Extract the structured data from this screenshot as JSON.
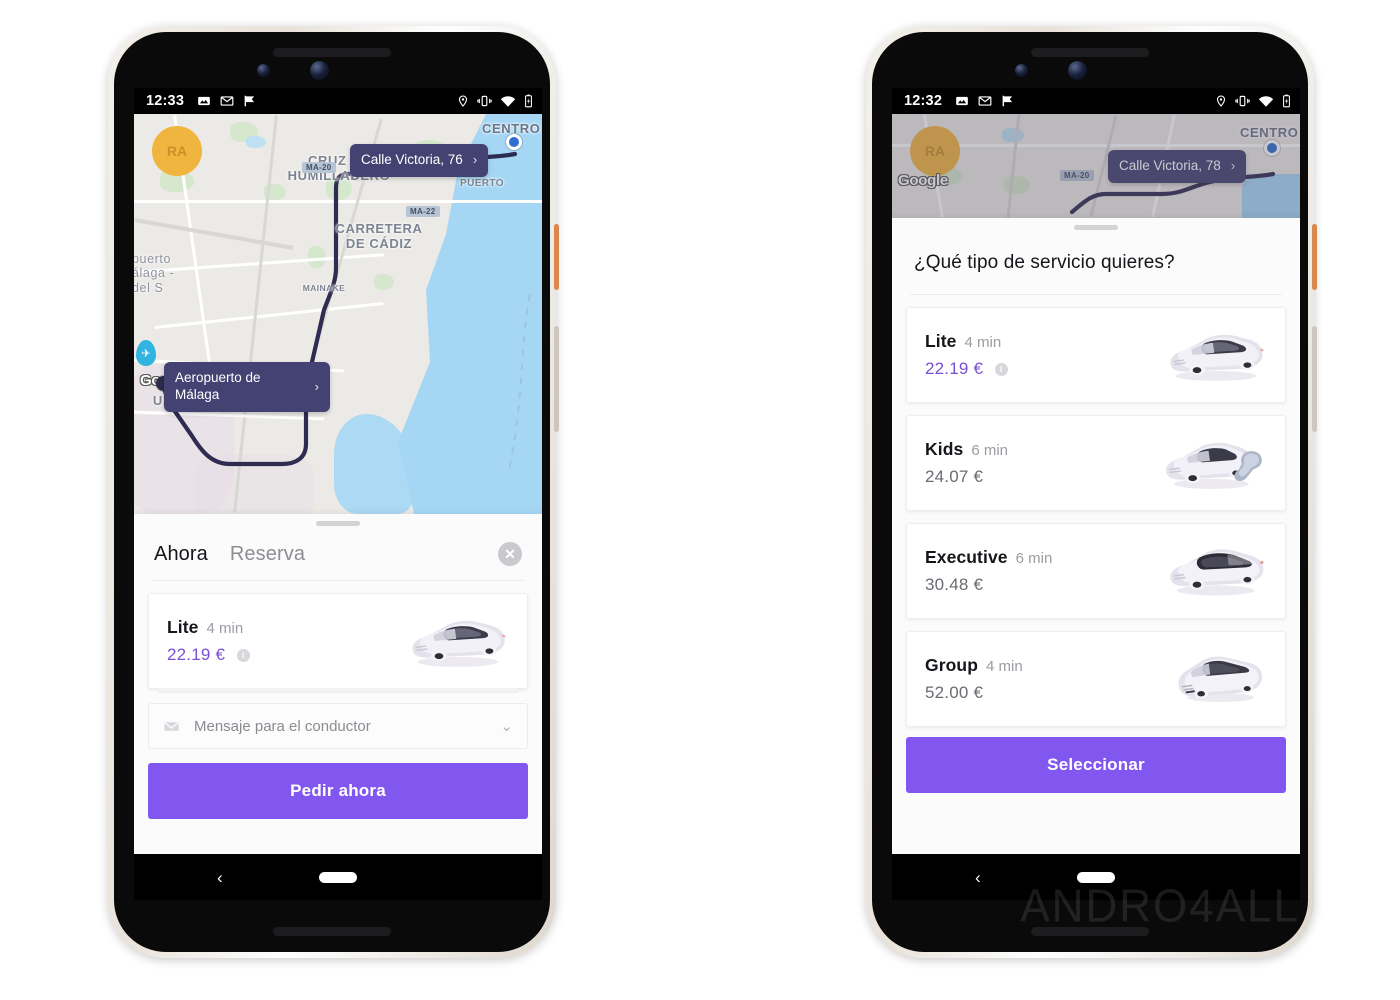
{
  "app": {
    "accent_purple": "#8257f0",
    "price_accent": "#7b4fd4",
    "callout_bg": "#434272"
  },
  "left_phone": {
    "status_bar": {
      "time": "12:33",
      "left_icons": [
        "image-icon",
        "gmail-icon",
        "flag-icon"
      ],
      "right_icons": [
        "location-icon",
        "vibrate-icon",
        "wifi-icon",
        "battery-icon"
      ]
    },
    "map": {
      "user_badge": "RA",
      "attribution": "Google",
      "labels": [
        "CENTRO",
        "CRUZ DE\nHUMILLADERO",
        "PUERTO",
        "CARRETERA\nDE CÁDIZ",
        "MAINAKE",
        "URRIANA"
      ],
      "label_centro": "CENTRO",
      "label_cruz": "CRUZ DE\nHUMILLADERO",
      "label_puerto": "PUERTO",
      "label_carretera": "CARRETERA\nDE CÁDIZ",
      "label_mainake": "MAINAKE",
      "label_urriana": "URRIANA",
      "label_aeropuerto_faint": "puerto\nálaga -\ndel S",
      "highway_1": "MA-20",
      "highway_2": "MA-22",
      "destination_callout": "Calle Victoria, 76",
      "origin_callout": "Aeropuerto de Málaga",
      "chevron": "›"
    },
    "sheet": {
      "tab_now": "Ahora",
      "tab_booking": "Reserva",
      "close_label": "✕",
      "service": {
        "name": "Lite",
        "eta": "4 min",
        "price": "22.19 €",
        "info_badge": "i"
      },
      "message_placeholder": "Mensaje para el conductor",
      "cta_label": "Pedir ahora"
    },
    "navbar": {
      "back": "‹"
    }
  },
  "right_phone": {
    "status_bar": {
      "time": "12:32",
      "left_icons": [
        "image-icon",
        "gmail-icon",
        "flag-icon"
      ],
      "right_icons": [
        "location-icon",
        "vibrate-icon",
        "wifi-icon",
        "battery-icon"
      ]
    },
    "map": {
      "user_badge": "RA",
      "attribution": "Google",
      "label_centro": "CENTRO",
      "highway_1": "MA-20",
      "destination_callout": "Calle Victoria, 78",
      "chevron": "›"
    },
    "sheet": {
      "title": "¿Qué tipo de servicio quieres?",
      "services": [
        {
          "name": "Lite",
          "eta": "4 min",
          "price": "22.19 €",
          "selected": true,
          "has_info": true,
          "info_badge": "i",
          "art": "sedan-icon"
        },
        {
          "name": "Kids",
          "eta": "6 min",
          "price": "24.07 €",
          "selected": false,
          "has_info": false,
          "info_badge": "",
          "art": "sedan-childseat-icon"
        },
        {
          "name": "Executive",
          "eta": "6 min",
          "price": "30.48 €",
          "selected": false,
          "has_info": false,
          "info_badge": "",
          "art": "executive-sedan-icon"
        },
        {
          "name": "Group",
          "eta": "4 min",
          "price": "52.00 €",
          "selected": false,
          "has_info": false,
          "info_badge": "",
          "art": "van-icon"
        }
      ],
      "cta_label": "Seleccionar"
    },
    "navbar": {
      "back": "‹"
    }
  },
  "watermark": {
    "text": "ANDRO4ALL"
  }
}
